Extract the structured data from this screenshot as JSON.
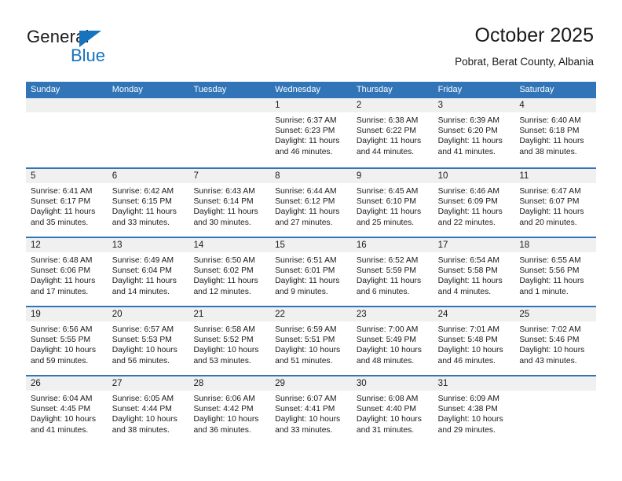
{
  "logo": {
    "word1": "General",
    "word2": "Blue",
    "triangle_color": "#1673bd"
  },
  "header": {
    "title": "October 2025",
    "subtitle": "Pobrat, Berat County, Albania"
  },
  "theme": {
    "accent": "#3175b8",
    "day_band": "#f0f0f0",
    "text": "#1a1a1a"
  },
  "weekdays": [
    "Sunday",
    "Monday",
    "Tuesday",
    "Wednesday",
    "Thursday",
    "Friday",
    "Saturday"
  ],
  "labels": {
    "sunrise": "Sunrise:",
    "sunset": "Sunset:",
    "daylight": "Daylight:"
  },
  "weeks": [
    [
      {
        "day": "",
        "sunrise": "",
        "sunset": "",
        "daylight_line1": "",
        "daylight_line2": ""
      },
      {
        "day": "",
        "sunrise": "",
        "sunset": "",
        "daylight_line1": "",
        "daylight_line2": ""
      },
      {
        "day": "",
        "sunrise": "",
        "sunset": "",
        "daylight_line1": "",
        "daylight_line2": ""
      },
      {
        "day": "1",
        "sunrise": "Sunrise: 6:37 AM",
        "sunset": "Sunset: 6:23 PM",
        "daylight_line1": "Daylight: 11 hours",
        "daylight_line2": "and 46 minutes."
      },
      {
        "day": "2",
        "sunrise": "Sunrise: 6:38 AM",
        "sunset": "Sunset: 6:22 PM",
        "daylight_line1": "Daylight: 11 hours",
        "daylight_line2": "and 44 minutes."
      },
      {
        "day": "3",
        "sunrise": "Sunrise: 6:39 AM",
        "sunset": "Sunset: 6:20 PM",
        "daylight_line1": "Daylight: 11 hours",
        "daylight_line2": "and 41 minutes."
      },
      {
        "day": "4",
        "sunrise": "Sunrise: 6:40 AM",
        "sunset": "Sunset: 6:18 PM",
        "daylight_line1": "Daylight: 11 hours",
        "daylight_line2": "and 38 minutes."
      }
    ],
    [
      {
        "day": "5",
        "sunrise": "Sunrise: 6:41 AM",
        "sunset": "Sunset: 6:17 PM",
        "daylight_line1": "Daylight: 11 hours",
        "daylight_line2": "and 35 minutes."
      },
      {
        "day": "6",
        "sunrise": "Sunrise: 6:42 AM",
        "sunset": "Sunset: 6:15 PM",
        "daylight_line1": "Daylight: 11 hours",
        "daylight_line2": "and 33 minutes."
      },
      {
        "day": "7",
        "sunrise": "Sunrise: 6:43 AM",
        "sunset": "Sunset: 6:14 PM",
        "daylight_line1": "Daylight: 11 hours",
        "daylight_line2": "and 30 minutes."
      },
      {
        "day": "8",
        "sunrise": "Sunrise: 6:44 AM",
        "sunset": "Sunset: 6:12 PM",
        "daylight_line1": "Daylight: 11 hours",
        "daylight_line2": "and 27 minutes."
      },
      {
        "day": "9",
        "sunrise": "Sunrise: 6:45 AM",
        "sunset": "Sunset: 6:10 PM",
        "daylight_line1": "Daylight: 11 hours",
        "daylight_line2": "and 25 minutes."
      },
      {
        "day": "10",
        "sunrise": "Sunrise: 6:46 AM",
        "sunset": "Sunset: 6:09 PM",
        "daylight_line1": "Daylight: 11 hours",
        "daylight_line2": "and 22 minutes."
      },
      {
        "day": "11",
        "sunrise": "Sunrise: 6:47 AM",
        "sunset": "Sunset: 6:07 PM",
        "daylight_line1": "Daylight: 11 hours",
        "daylight_line2": "and 20 minutes."
      }
    ],
    [
      {
        "day": "12",
        "sunrise": "Sunrise: 6:48 AM",
        "sunset": "Sunset: 6:06 PM",
        "daylight_line1": "Daylight: 11 hours",
        "daylight_line2": "and 17 minutes."
      },
      {
        "day": "13",
        "sunrise": "Sunrise: 6:49 AM",
        "sunset": "Sunset: 6:04 PM",
        "daylight_line1": "Daylight: 11 hours",
        "daylight_line2": "and 14 minutes."
      },
      {
        "day": "14",
        "sunrise": "Sunrise: 6:50 AM",
        "sunset": "Sunset: 6:02 PM",
        "daylight_line1": "Daylight: 11 hours",
        "daylight_line2": "and 12 minutes."
      },
      {
        "day": "15",
        "sunrise": "Sunrise: 6:51 AM",
        "sunset": "Sunset: 6:01 PM",
        "daylight_line1": "Daylight: 11 hours",
        "daylight_line2": "and 9 minutes."
      },
      {
        "day": "16",
        "sunrise": "Sunrise: 6:52 AM",
        "sunset": "Sunset: 5:59 PM",
        "daylight_line1": "Daylight: 11 hours",
        "daylight_line2": "and 6 minutes."
      },
      {
        "day": "17",
        "sunrise": "Sunrise: 6:54 AM",
        "sunset": "Sunset: 5:58 PM",
        "daylight_line1": "Daylight: 11 hours",
        "daylight_line2": "and 4 minutes."
      },
      {
        "day": "18",
        "sunrise": "Sunrise: 6:55 AM",
        "sunset": "Sunset: 5:56 PM",
        "daylight_line1": "Daylight: 11 hours",
        "daylight_line2": "and 1 minute."
      }
    ],
    [
      {
        "day": "19",
        "sunrise": "Sunrise: 6:56 AM",
        "sunset": "Sunset: 5:55 PM",
        "daylight_line1": "Daylight: 10 hours",
        "daylight_line2": "and 59 minutes."
      },
      {
        "day": "20",
        "sunrise": "Sunrise: 6:57 AM",
        "sunset": "Sunset: 5:53 PM",
        "daylight_line1": "Daylight: 10 hours",
        "daylight_line2": "and 56 minutes."
      },
      {
        "day": "21",
        "sunrise": "Sunrise: 6:58 AM",
        "sunset": "Sunset: 5:52 PM",
        "daylight_line1": "Daylight: 10 hours",
        "daylight_line2": "and 53 minutes."
      },
      {
        "day": "22",
        "sunrise": "Sunrise: 6:59 AM",
        "sunset": "Sunset: 5:51 PM",
        "daylight_line1": "Daylight: 10 hours",
        "daylight_line2": "and 51 minutes."
      },
      {
        "day": "23",
        "sunrise": "Sunrise: 7:00 AM",
        "sunset": "Sunset: 5:49 PM",
        "daylight_line1": "Daylight: 10 hours",
        "daylight_line2": "and 48 minutes."
      },
      {
        "day": "24",
        "sunrise": "Sunrise: 7:01 AM",
        "sunset": "Sunset: 5:48 PM",
        "daylight_line1": "Daylight: 10 hours",
        "daylight_line2": "and 46 minutes."
      },
      {
        "day": "25",
        "sunrise": "Sunrise: 7:02 AM",
        "sunset": "Sunset: 5:46 PM",
        "daylight_line1": "Daylight: 10 hours",
        "daylight_line2": "and 43 minutes."
      }
    ],
    [
      {
        "day": "26",
        "sunrise": "Sunrise: 6:04 AM",
        "sunset": "Sunset: 4:45 PM",
        "daylight_line1": "Daylight: 10 hours",
        "daylight_line2": "and 41 minutes."
      },
      {
        "day": "27",
        "sunrise": "Sunrise: 6:05 AM",
        "sunset": "Sunset: 4:44 PM",
        "daylight_line1": "Daylight: 10 hours",
        "daylight_line2": "and 38 minutes."
      },
      {
        "day": "28",
        "sunrise": "Sunrise: 6:06 AM",
        "sunset": "Sunset: 4:42 PM",
        "daylight_line1": "Daylight: 10 hours",
        "daylight_line2": "and 36 minutes."
      },
      {
        "day": "29",
        "sunrise": "Sunrise: 6:07 AM",
        "sunset": "Sunset: 4:41 PM",
        "daylight_line1": "Daylight: 10 hours",
        "daylight_line2": "and 33 minutes."
      },
      {
        "day": "30",
        "sunrise": "Sunrise: 6:08 AM",
        "sunset": "Sunset: 4:40 PM",
        "daylight_line1": "Daylight: 10 hours",
        "daylight_line2": "and 31 minutes."
      },
      {
        "day": "31",
        "sunrise": "Sunrise: 6:09 AM",
        "sunset": "Sunset: 4:38 PM",
        "daylight_line1": "Daylight: 10 hours",
        "daylight_line2": "and 29 minutes."
      },
      {
        "day": "",
        "sunrise": "",
        "sunset": "",
        "daylight_line1": "",
        "daylight_line2": ""
      }
    ]
  ]
}
